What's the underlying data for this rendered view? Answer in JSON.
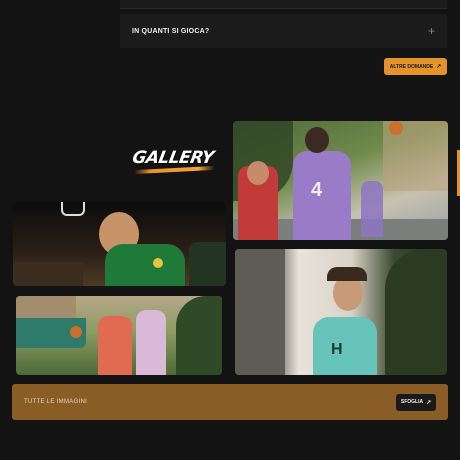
{
  "faq": {
    "question": "IN QUANTI SI GIOCA?",
    "expand_icon": "plus-icon"
  },
  "more_questions": {
    "label": "ALTRE DOMANDE",
    "icon": "arrow-up-right-icon"
  },
  "gallery": {
    "title": "GALLERY",
    "photos": [
      {
        "name": "gallery-photo-player-4-purple"
      },
      {
        "name": "gallery-photo-player-green-jersey"
      },
      {
        "name": "gallery-photo-player-teal-jersey"
      },
      {
        "name": "gallery-photo-players-outdoor-court"
      }
    ]
  },
  "all_images": {
    "label": "TUTTE LE IMMAGINI",
    "browse_label": "SFOGLIA",
    "browse_icon": "arrow-up-right-icon"
  },
  "colors": {
    "background": "#131313",
    "accent": "#e4922a",
    "banner": "#8a5d26"
  }
}
